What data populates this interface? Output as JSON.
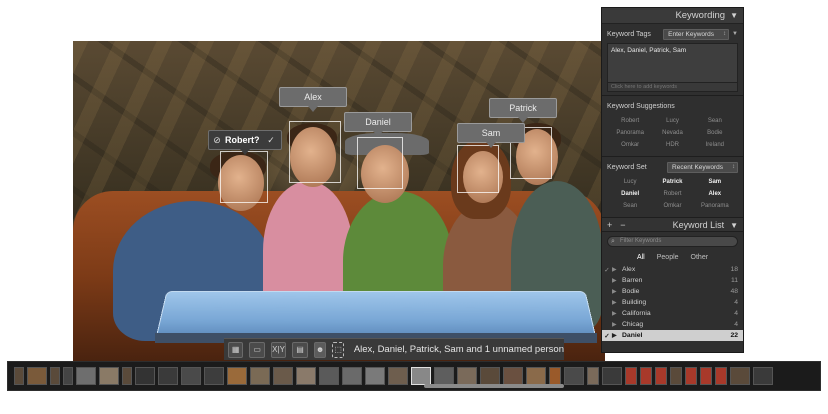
{
  "colors": {
    "panel_bg": "#2f2f2f",
    "filmstrip_bg": "#1b1b1b",
    "tag_bg": "#6c6c6c",
    "selected_row": "#cfcfcf",
    "table_blue": "#7aa8d6"
  },
  "face_tags": {
    "unconfirmed": {
      "label": "Robert?",
      "reject_icon": "circle-slash-icon",
      "confirm_icon": "checkmark-icon"
    },
    "alex": "Alex",
    "daniel": "Daniel",
    "sam": "Sam",
    "patrick": "Patrick"
  },
  "toolbar": {
    "grid_icon": "grid-view-icon",
    "loupe_icon": "loupe-view-icon",
    "compare_label": "X|Y",
    "survey_icon": "survey-view-icon",
    "people_icon": "people-face-icon",
    "draw_face_icon": "draw-face-region-icon",
    "summary": "Alex, Daniel, Patrick, Sam and 1 unnamed person"
  },
  "panel": {
    "title": "Keywording",
    "keyword_tags": {
      "label": "Keyword Tags",
      "mode": "Enter Keywords",
      "value": "Alex, Daniel, Patrick, Sam",
      "add_hint": "Click here to add keywords"
    },
    "suggestions": {
      "label": "Keyword Suggestions",
      "items": [
        "Robert",
        "Lucy",
        "Sean",
        "Panorama",
        "Nevada",
        "Bodie",
        "Omkar",
        "HDR",
        "Ireland"
      ]
    },
    "keyword_set": {
      "label": "Keyword Set",
      "preset": "Recent Keywords",
      "items": [
        {
          "t": "Lucy",
          "b": false
        },
        {
          "t": "Patrick",
          "b": true
        },
        {
          "t": "Sam",
          "b": true
        },
        {
          "t": "Daniel",
          "b": true
        },
        {
          "t": "Robert",
          "b": false
        },
        {
          "t": "Alex",
          "b": true
        },
        {
          "t": "Sean",
          "b": false
        },
        {
          "t": "Omkar",
          "b": false
        },
        {
          "t": "Panorama",
          "b": false
        }
      ]
    }
  },
  "keyword_list": {
    "title": "Keyword List",
    "plus": "+",
    "minus": "−",
    "search_placeholder": "Filter Keywords",
    "filters": [
      "All",
      "People",
      "Other"
    ],
    "rows": [
      {
        "name": "Alex",
        "count": "18",
        "checked": true,
        "selected": false
      },
      {
        "name": "Barren",
        "count": "11",
        "checked": false,
        "selected": false
      },
      {
        "name": "Bodie",
        "count": "48",
        "checked": false,
        "selected": false
      },
      {
        "name": "Building",
        "count": "4",
        "checked": false,
        "selected": false
      },
      {
        "name": "California",
        "count": "4",
        "checked": false,
        "selected": false
      },
      {
        "name": "Chicag",
        "count": "4",
        "checked": false,
        "selected": false
      },
      {
        "name": "Daniel",
        "count": "22",
        "checked": true,
        "selected": true
      }
    ]
  }
}
